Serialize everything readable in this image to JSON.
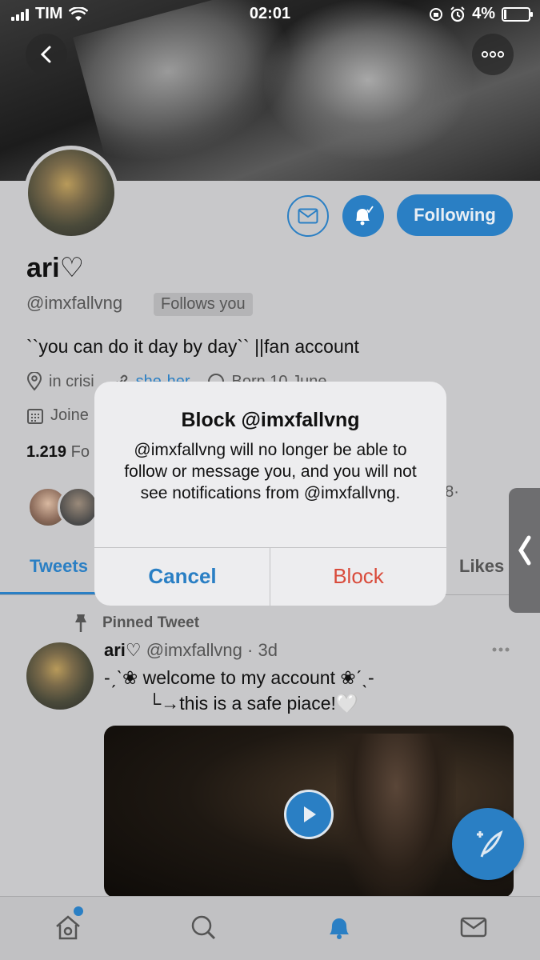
{
  "status_bar": {
    "carrier": "TIM",
    "time": "02:01",
    "battery": "4%"
  },
  "profile": {
    "name": "ari♡",
    "handle": "@imxfallvng",
    "follows_you": "Follows you",
    "bio": "``you can do it day by day`` ||fan account",
    "location": "in crisi",
    "website": "she-her",
    "born": "Born 10 June",
    "joined": "Joine",
    "following_count": "1.219",
    "following_label": "Fo",
    "followers_known": "28·",
    "following_button": "Following"
  },
  "tabs": [
    {
      "label": "Tweets"
    },
    {
      "label": "Likes"
    }
  ],
  "pinned_tweet": {
    "pinned_label": "Pinned Tweet",
    "author_name": "ari♡",
    "author_handle": "@imxfallvng",
    "age": "3d",
    "line1": "-ˏˋ❀ welcome to my account ❀ˊˎ-",
    "line2": "└→this is a safe piace!🤍"
  },
  "alert": {
    "title": "Block @imxfallvng",
    "message": "@imxfallvng will no longer be able to follow or message you, and you will not see notifications from @imxfallvng.",
    "cancel_label": "Cancel",
    "block_label": "Block"
  },
  "colors": {
    "accent": "#2a7fc4",
    "destructive": "#d94b3b"
  },
  "icons": [
    "back-icon",
    "more-icon",
    "mail-icon",
    "bell-icon",
    "location-icon",
    "link-icon",
    "birthday-icon",
    "calendar-icon",
    "pin-icon",
    "play-icon",
    "compose-icon",
    "home-icon",
    "search-icon",
    "notifications-icon",
    "messages-icon",
    "chevron-left-icon"
  ]
}
